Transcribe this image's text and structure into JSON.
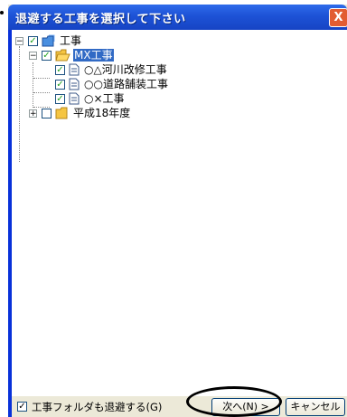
{
  "window": {
    "title": "退避する工事を選択して下さい",
    "close_label": "X"
  },
  "tree": [
    {
      "label": "工事",
      "checked": true,
      "expander": "−",
      "icon": "blue-folder-icon"
    },
    {
      "label": "MX工事",
      "checked": true,
      "expander": "−",
      "icon": "open-folder-icon",
      "selected": true
    },
    {
      "label": "○△河川改修工事",
      "checked": true,
      "icon": "document-icon"
    },
    {
      "label": "○○道路舗装工事",
      "checked": true,
      "icon": "document-icon"
    },
    {
      "label": "○×工事",
      "checked": true,
      "icon": "document-icon"
    },
    {
      "label": "平成18年度",
      "checked": false,
      "expander": "+",
      "icon": "folder-icon"
    }
  ],
  "footer": {
    "include_folder_label": "工事フォルダも退避する(G)",
    "include_folder_checked": true,
    "next_label": "次へ(N) >",
    "cancel_label": "キャンセル"
  },
  "colors": {
    "title_bar": "#1d52d6",
    "selection": "#316ac5",
    "close_button": "#e25c32"
  }
}
